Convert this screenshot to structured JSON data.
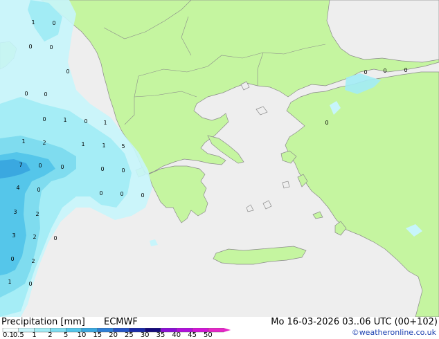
{
  "title": "Precipitation [mm]",
  "model": "ECMWF",
  "valid": "Mo 16-03-2026 03..06 UTC (00+102)",
  "credit": "©weatheronline.co.uk",
  "legend": {
    "ticks": [
      "0.1",
      "0.5",
      "1",
      "2",
      "5",
      "10",
      "15",
      "20",
      "25",
      "30",
      "35",
      "40",
      "45",
      "50"
    ],
    "colors": [
      "#f5fefe",
      "#c7f5fb",
      "#a2ecf5",
      "#7fdcef",
      "#55c6ea",
      "#3aa8e0",
      "#2f7fd6",
      "#2555c6",
      "#1a2aa8",
      "#150a7c",
      "#8a0ed6",
      "#b10fdc",
      "#d414d8",
      "#e626c8"
    ]
  },
  "colors": {
    "land": "#c5f5a0",
    "sea": "#eeeeee",
    "coast": "#8a8a8a"
  },
  "map_labels": [
    "1",
    "0",
    "0",
    "0",
    "0",
    "0",
    "0",
    "0",
    "1",
    "0",
    "1",
    "1",
    "2",
    "1",
    "1",
    "5",
    "7",
    "0",
    "0",
    "4",
    "0",
    "0",
    "0",
    "3",
    "2",
    "3",
    "2",
    "0",
    "0",
    "2",
    "1",
    "0",
    "0",
    "0",
    "0",
    "0",
    "0",
    "0",
    "0"
  ]
}
